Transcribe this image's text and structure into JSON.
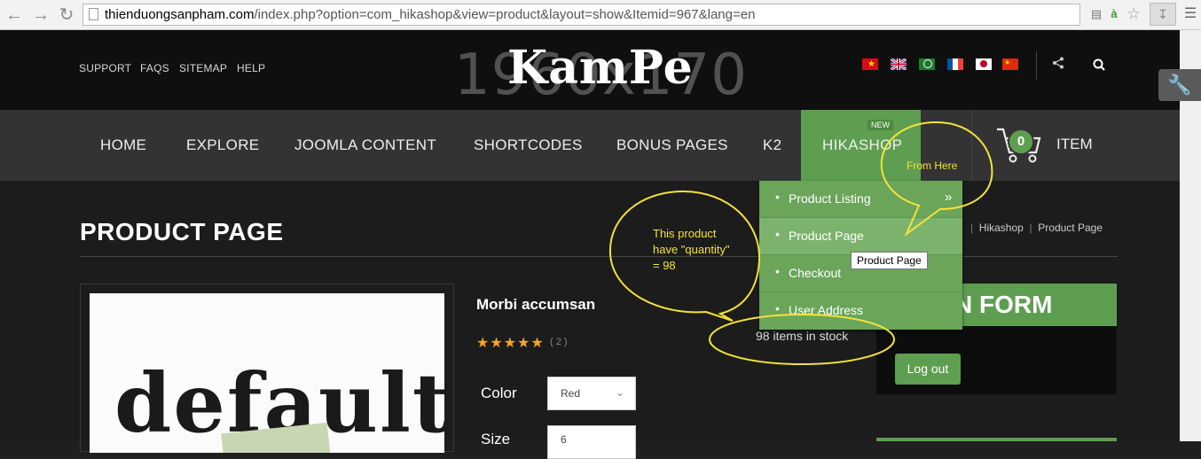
{
  "browser": {
    "url_domain": "thienduongsanpham.com",
    "url_path": "/index.php?option=com_hikashop&view=product&layout=show&Itemid=967&lang=en"
  },
  "header": {
    "links": [
      "SUPPORT",
      "FAQS",
      "SITEMAP",
      "HELP"
    ],
    "logo": "KamPe",
    "placeholder": "1960x170",
    "flags": [
      "vietnam-flag",
      "uk-flag",
      "arabic-flag",
      "france-flag",
      "japan-flag",
      "china-flag"
    ],
    "share_icon": "share-icon",
    "search_icon": "search-icon"
  },
  "nav": {
    "items": [
      "HOME",
      "EXPLORE",
      "JOOMLA CONTENT",
      "SHORTCODES",
      "BONUS PAGES",
      "K2",
      "HIKASHOP"
    ],
    "new_badge": "NEW",
    "cart_count": "0",
    "cart_label": "ITEM"
  },
  "dropdown": {
    "items": [
      "Product Listing",
      "Product Page",
      "Checkout",
      "User Address"
    ],
    "tooltip": "Product Page"
  },
  "page": {
    "title": "PRODUCT PAGE",
    "breadcrumb": [
      "Hikashop",
      "Product Page"
    ],
    "image_text": "default"
  },
  "product": {
    "name": "Morbi accumsan",
    "stars": "★★★★★",
    "rating_count": "( 2 )",
    "stock": "98 items in stock",
    "color_label": "Color",
    "color_value": "Red",
    "size_label": "Size",
    "size_value": "6"
  },
  "login": {
    "title_partial": "N FORM",
    "logout": "Log out"
  },
  "annotations": {
    "from_here": "From Here",
    "quantity_note_1": "This product",
    "quantity_note_2": "have \"quantity\"",
    "quantity_note_3": "= 98"
  },
  "colors": {
    "accent": "#5e9e50",
    "annotation": "#f4e23a"
  }
}
